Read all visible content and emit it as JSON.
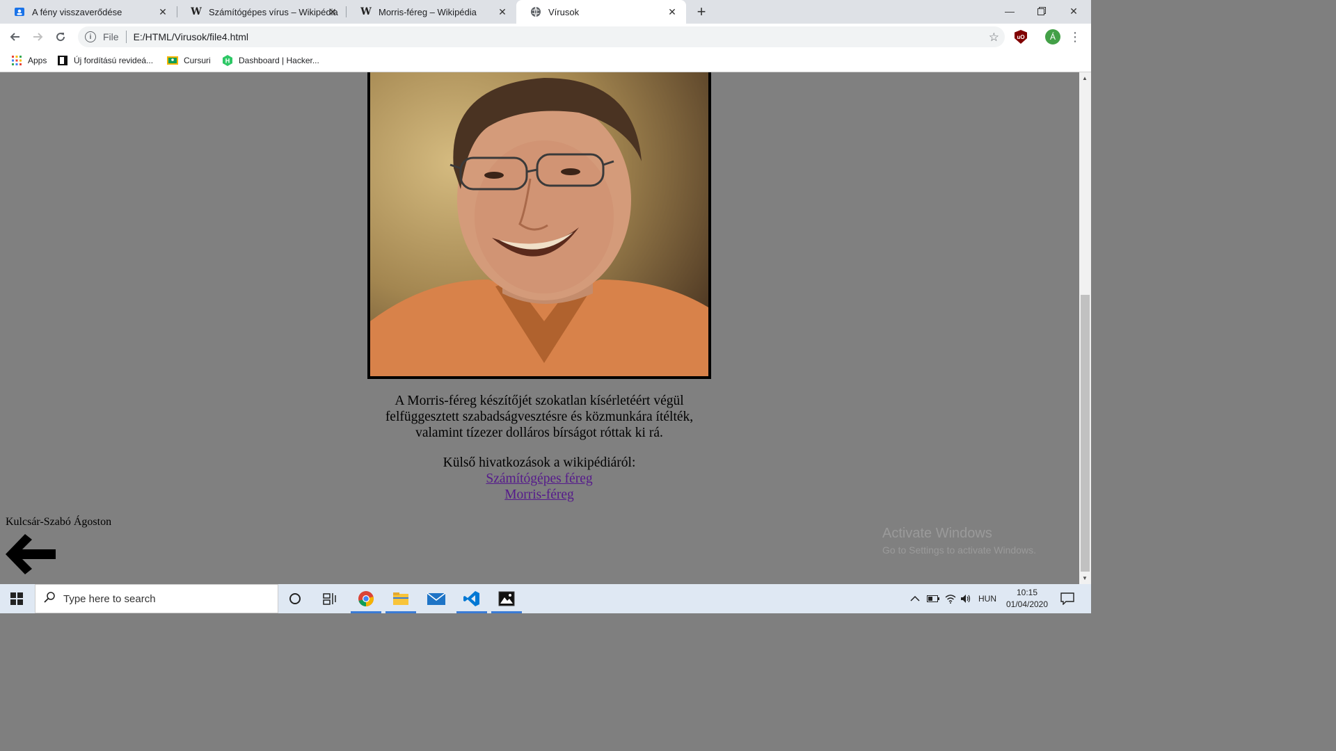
{
  "browser": {
    "tabs": [
      {
        "title": "A fény visszaverődése",
        "favicon": "contact-card-icon",
        "active": false
      },
      {
        "title": "Számítógépes vírus – Wikipédia",
        "favicon": "wikipedia-icon",
        "active": false
      },
      {
        "title": "Morris-féreg – Wikipédia",
        "favicon": "wikipedia-icon",
        "active": false
      },
      {
        "title": "Vírusok",
        "favicon": "globe-icon",
        "active": true
      }
    ],
    "wiki_letter": "W",
    "address": {
      "scheme_label": "File",
      "url": "E:/HTML/Virusok/file4.html"
    },
    "profile_initial": "Á",
    "bookmarks": [
      {
        "label": "Apps",
        "icon": "apps-grid-icon"
      },
      {
        "label": "Új fordítású revideá...",
        "icon": "book-icon"
      },
      {
        "label": "Cursuri",
        "icon": "classroom-icon"
      },
      {
        "label": "Dashboard | Hacker...",
        "icon": "hackerrank-icon"
      }
    ]
  },
  "page": {
    "paragraph_lines": [
      "A Morris-féreg készítőjét szokatlan kísérletéért végül",
      "felfüggesztett szabadságvesztésre és közmunkára ítélték,",
      "valamint tízezer dolláros bírságot róttak ki rá."
    ],
    "links_heading": "Külső hivatkozások a wikipédiáról:",
    "links": [
      "Számítógépes féreg",
      "Morris-féreg"
    ],
    "author": "Kulcsár-Szabó Ágoston"
  },
  "watermark": {
    "line1": "Activate Windows",
    "line2": "Go to Settings to activate Windows."
  },
  "taskbar": {
    "search_placeholder": "Type here to search",
    "language": "HUN",
    "time": "10:15",
    "date": "01/04/2020"
  },
  "colors": {
    "page_background": "#808080",
    "link": "#551a8b",
    "tabstrip": "#dee1e6"
  }
}
